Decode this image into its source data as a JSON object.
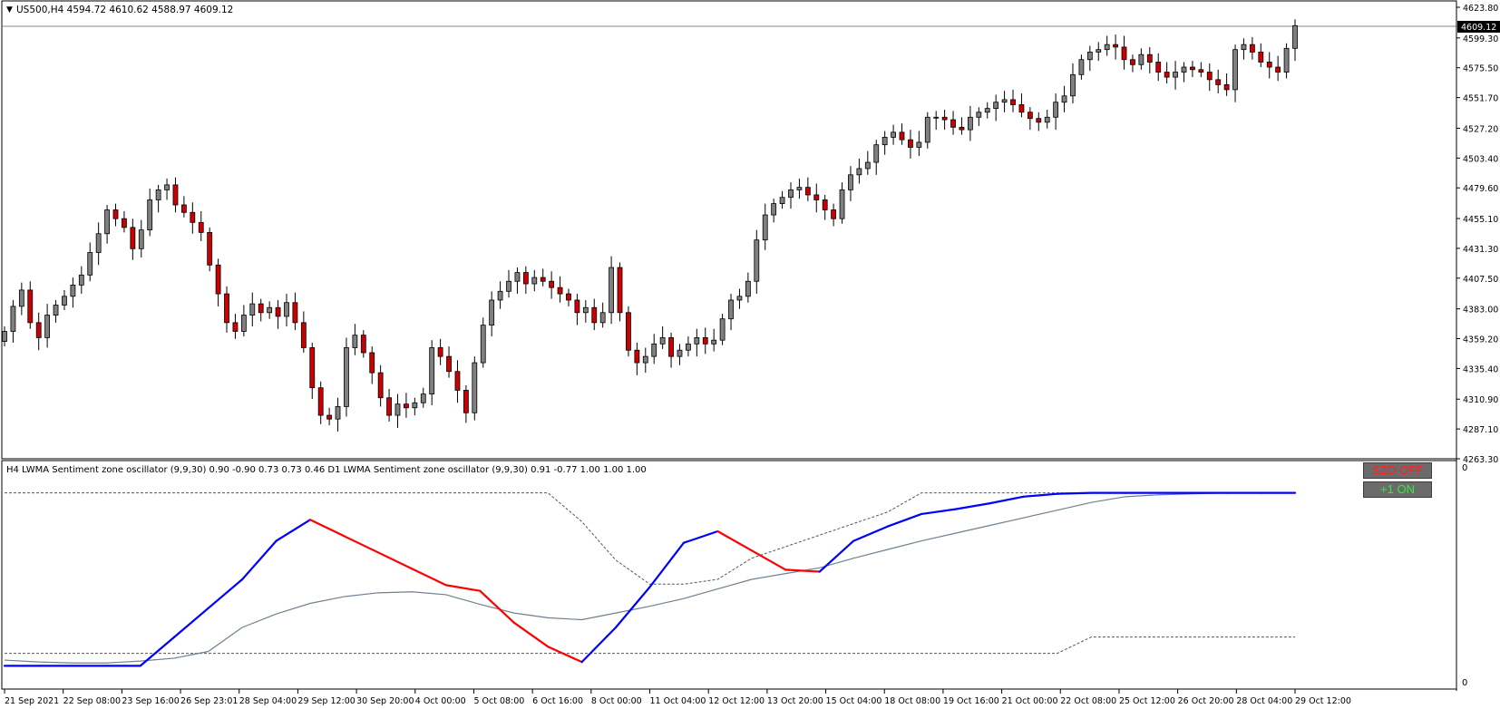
{
  "main_chart": {
    "symbol_header": "US500,H4  4594.72 4610.62 4588.97 4609.12",
    "current_price_label": "4609.12",
    "price_ticks": [
      "4623.80",
      "4599.30",
      "4575.50",
      "4551.70",
      "4527.20",
      "4503.40",
      "4479.60",
      "4455.10",
      "4431.30",
      "4407.50",
      "4383.00",
      "4359.20",
      "4335.40",
      "4310.90",
      "4287.10",
      "4263.30"
    ],
    "price_range": [
      4263.3,
      4623.8
    ],
    "current_price": 4609.12
  },
  "indicator": {
    "header": "H4 LWMA Sentiment zone oscillator (9,9,30) 0.90 -0.90 0.73 0.73 0.46  D1 LWMA Sentiment zone oscillator (9,9,30) 0.91 -0.77 1.00 1.00 1.00",
    "scale_top": "0",
    "scale_bottom": "0",
    "btn_szo": "SZO OFF",
    "btn_plus1": "+1 ON"
  },
  "time_axis": {
    "labels": [
      "21 Sep 2021",
      "22 Sep 08:00",
      "23 Sep 16:00",
      "26 Sep 23:01",
      "28 Sep 04:00",
      "29 Sep 12:00",
      "30 Sep 20:00",
      "4 Oct 00:00",
      "5 Oct 08:00",
      "6 Oct 16:00",
      "8 Oct 00:00",
      "11 Oct 04:00",
      "12 Oct 12:00",
      "13 Oct 20:00",
      "15 Oct 04:00",
      "18 Oct 08:00",
      "19 Oct 16:00",
      "21 Oct 00:00",
      "22 Oct 08:00",
      "25 Oct 12:00",
      "26 Oct 20:00",
      "28 Oct 04:00",
      "29 Oct 12:00"
    ]
  },
  "colors": {
    "bull_candle": "#808080",
    "bear_candle": "#cc0000",
    "candle_outline": "#000000",
    "osc_up": "#0000ff",
    "osc_down": "#ff0000",
    "signal_line": "#708090",
    "szo_text": "#ff0000",
    "plus1_text": "#00dd00"
  },
  "chart_data": [
    {
      "type": "candlestick",
      "title": "US500,H4",
      "y_range": [
        4263.3,
        4623.8
      ],
      "close": [
        4365,
        4385,
        4398,
        4372,
        4360,
        4378,
        4386,
        4393,
        4402,
        4410,
        4428,
        4443,
        4462,
        4455,
        4448,
        4431,
        4446,
        4470,
        4478,
        4482,
        4466,
        4460,
        4452,
        4444,
        4418,
        4395,
        4372,
        4365,
        4378,
        4387,
        4380,
        4384,
        4377,
        4388,
        4372,
        4352,
        4320,
        4298,
        4295,
        4305,
        4352,
        4362,
        4348,
        4332,
        4312,
        4298,
        4307,
        4304,
        4308,
        4315,
        4352,
        4345,
        4333,
        4318,
        4300,
        4340,
        4370,
        4390,
        4397,
        4405,
        4412,
        4403,
        4408,
        4405,
        4400,
        4395,
        4390,
        4380,
        4384,
        4372,
        4380,
        4416,
        4380,
        4350,
        4340,
        4345,
        4355,
        4360,
        4345,
        4350,
        4355,
        4360,
        4355,
        4358,
        4375,
        4390,
        4393,
        4405,
        4438,
        4458,
        4467,
        4472,
        4478,
        4480,
        4474,
        4470,
        4462,
        4455,
        4478,
        4490,
        4495,
        4500,
        4514,
        4520,
        4524,
        4518,
        4512,
        4516,
        4536,
        4536,
        4534,
        4528,
        4526,
        4536,
        4540,
        4543,
        4548,
        4550,
        4546,
        4540,
        4535,
        4532,
        4536,
        4548,
        4553,
        4570,
        4582,
        4588,
        4590,
        4594,
        4592,
        4582,
        4578,
        4586,
        4580,
        4572,
        4568,
        4572,
        4576,
        4574,
        4572,
        4566,
        4562,
        4558,
        4590,
        4594,
        4588,
        4580,
        4576,
        4572,
        4591,
        4609.12
      ]
    },
    {
      "type": "line",
      "title": "H4 LWMA Sentiment zone oscillator (9,9,30)",
      "series": [
        {
          "name": "SZO",
          "values": [
            -0.9,
            -0.9,
            -0.9,
            -0.9,
            -0.9,
            -0.6,
            -0.3,
            0.0,
            0.4,
            0.62,
            0.45,
            0.28,
            0.11,
            -0.06,
            -0.12,
            -0.45,
            -0.7,
            -0.86,
            -0.5,
            -0.08,
            0.38,
            0.5,
            0.3,
            0.1,
            0.08,
            0.4,
            0.55,
            0.68,
            0.73,
            0.79,
            0.86,
            0.89,
            0.9,
            0.9,
            0.9,
            0.9,
            0.9,
            0.9,
            0.9
          ]
        },
        {
          "name": "Signal",
          "values": [
            -0.84,
            -0.86,
            -0.87,
            -0.87,
            -0.85,
            -0.82,
            -0.75,
            -0.5,
            -0.36,
            -0.25,
            -0.18,
            -0.14,
            -0.13,
            -0.16,
            -0.26,
            -0.35,
            -0.4,
            -0.42,
            -0.35,
            -0.28,
            -0.2,
            -0.1,
            0.0,
            0.06,
            0.12,
            0.22,
            0.31,
            0.4,
            0.48,
            0.56,
            0.64,
            0.72,
            0.8,
            0.86,
            0.88,
            0.89,
            0.9,
            0.9,
            0.9
          ]
        }
      ],
      "levels": [
        0.9,
        0.46,
        -0.77
      ]
    }
  ]
}
